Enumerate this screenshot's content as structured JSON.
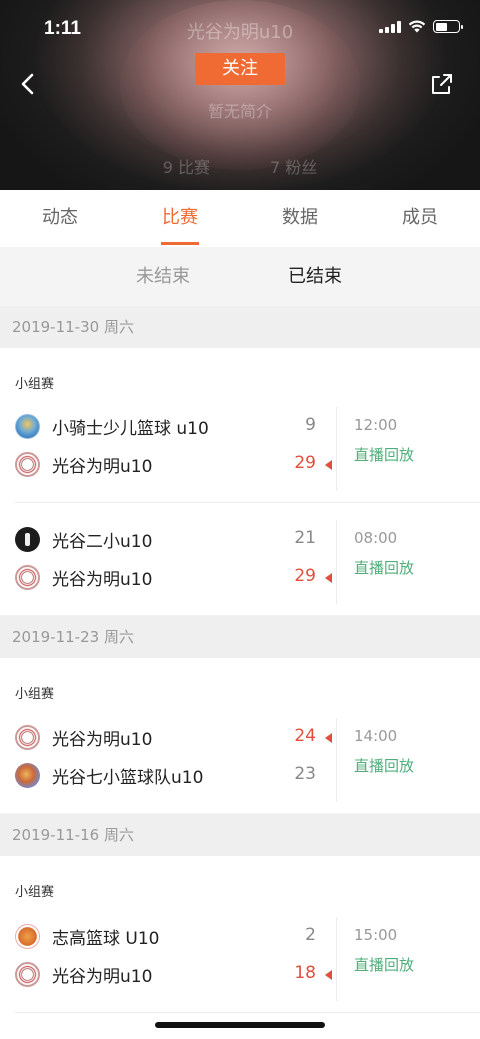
{
  "status_bar": {
    "time": "1:11"
  },
  "header": {
    "team_name": "光谷为明u10",
    "follow_label": "关注",
    "intro": "暂无简介",
    "matches_count": "9 比赛",
    "fans_count": "7 粉丝"
  },
  "tabs": [
    {
      "label": "动态",
      "active": false
    },
    {
      "label": "比赛",
      "active": true
    },
    {
      "label": "数据",
      "active": false
    },
    {
      "label": "成员",
      "active": false
    }
  ],
  "subtabs": {
    "unfinished": "未结束",
    "finished": "已结束"
  },
  "sections": [
    {
      "date": "2019-11-30 周六",
      "group": "小组赛",
      "matches": [
        {
          "team1": {
            "name": "小骑士少儿篮球 u10",
            "logo": "knight-logo",
            "score": "9",
            "win": false
          },
          "team2": {
            "name": "光谷为明u10",
            "logo": "owner-logo",
            "score": "29",
            "win": true
          },
          "time": "12:00",
          "replay": "直播回放"
        },
        {
          "team1": {
            "name": "光谷二小u10",
            "logo": "dark-logo",
            "score": "21",
            "win": false
          },
          "team2": {
            "name": "光谷为明u10",
            "logo": "owner-logo",
            "score": "29",
            "win": true
          },
          "time": "08:00",
          "replay": "直播回放"
        }
      ]
    },
    {
      "date": "2019-11-23 周六",
      "group": "小组赛",
      "matches": [
        {
          "team1": {
            "name": "光谷为明u10",
            "logo": "owner-logo",
            "score": "24",
            "win": true
          },
          "team2": {
            "name": "光谷七小篮球队u10",
            "logo": "seven-logo",
            "score": "23",
            "win": false
          },
          "time": "14:00",
          "replay": "直播回放"
        }
      ]
    },
    {
      "date": "2019-11-16 周六",
      "group": "小组赛",
      "matches": [
        {
          "team1": {
            "name": "志高篮球 U10",
            "logo": "zhigao-logo",
            "score": "2",
            "win": false
          },
          "team2": {
            "name": "光谷为明u10",
            "logo": "owner-logo",
            "score": "18",
            "win": true
          },
          "time": "15:00",
          "replay": "直播回放"
        }
      ]
    }
  ],
  "colors": {
    "accent": "#ef6b33",
    "win_score": "#e14d3e",
    "replay": "#4fae7a"
  }
}
